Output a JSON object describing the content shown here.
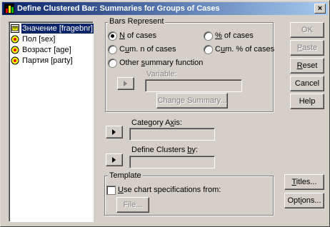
{
  "window": {
    "title": "Define Clustered Bar: Summaries for Groups of Cases",
    "close_label": "×"
  },
  "variables": [
    {
      "label": "Значение [fragebnr]",
      "selected": true,
      "icon": "ruler-icon"
    },
    {
      "label": "Пол [sex]",
      "selected": false,
      "icon": "variable-icon"
    },
    {
      "label": "Возраст [age]",
      "selected": false,
      "icon": "variable-icon"
    },
    {
      "label": "Партия [party]",
      "selected": false,
      "icon": "variable-icon"
    }
  ],
  "bars_represent": {
    "legend": "Bars Represent",
    "n_of_cases": "N of cases",
    "pct_of_cases": "% of cases",
    "cum_n_of_cases": "Cum. n of cases",
    "cum_pct_of_cases": "Cum. % of cases",
    "other_summary": "Other summary function",
    "variable_label": "Variable:",
    "change_summary": "Change Summary..."
  },
  "category_axis": {
    "label": "Category Axis:",
    "value": ""
  },
  "define_clusters": {
    "label": "Define Clusters by:",
    "value": ""
  },
  "template": {
    "legend": "Template",
    "use_chart_spec": "Use chart specifications from:",
    "file_button": "File..."
  },
  "buttons": {
    "ok": "OK",
    "paste": "Paste",
    "reset": "Reset",
    "cancel": "Cancel",
    "help": "Help",
    "titles": "Titles...",
    "options": "Options..."
  }
}
